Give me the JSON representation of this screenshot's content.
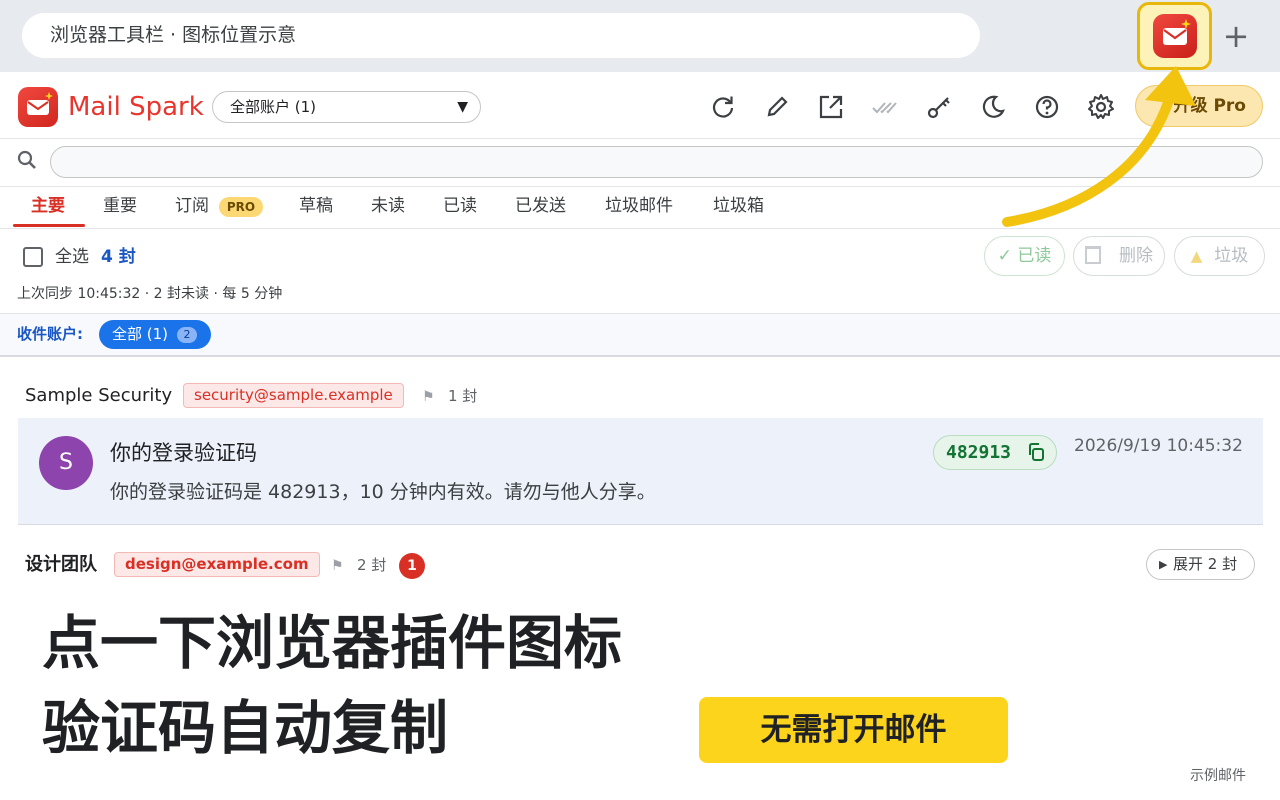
{
  "browser": {
    "address_text": "浏览器工具栏 · 图标位置示意",
    "new_tab_symbol": "+",
    "extension_icon": "mail-extension-icon",
    "highlight_color": "#e8b70c"
  },
  "app": {
    "title": "Mail Spark",
    "account_select_value": "全部账户 (1)",
    "upgrade_label": "升级 Pro",
    "toolbar_icons": [
      "refresh-icon",
      "edit-icon",
      "open-external-icon",
      "mark-read-icon",
      "key-icon",
      "dark-mode-icon",
      "help-icon",
      "settings-icon"
    ]
  },
  "search": {
    "placeholder": ""
  },
  "tabs": [
    {
      "label": "主要",
      "active": true
    },
    {
      "label": "重要"
    },
    {
      "label": "订阅",
      "badge": "PRO"
    },
    {
      "label": "草稿"
    },
    {
      "label": "未读"
    },
    {
      "label": "已读"
    },
    {
      "label": "已发送"
    },
    {
      "label": "垃圾邮件"
    },
    {
      "label": "垃圾箱"
    }
  ],
  "select_row": {
    "select_all_label": "全选",
    "count_label": "4 封",
    "btn_read": "✓ 已读",
    "btn_delete": "删除",
    "btn_junk": "垃圾"
  },
  "sync_status": "上次同步 10:45:32 · 2 封未读 · 每 5 分钟",
  "accounts_filter": {
    "label": "收件账户:",
    "chip_label": "全部 (1)",
    "chip_count": "2"
  },
  "groups": [
    {
      "sender": "Sample Security",
      "email": "security@sample.example",
      "count": "1 封",
      "mail": {
        "avatar_letter": "S",
        "subject": "你的登录验证码",
        "preview": "你的登录验证码是 482913，10 分钟内有效。请勿与他人分享。",
        "code": "482913",
        "date": "2026/9/19 10:45:32"
      }
    },
    {
      "sender": "设计团队",
      "email": "design@example.com",
      "count": "2 封",
      "unread": "1",
      "expand_label": "展开 2 封"
    }
  ],
  "caption": {
    "line1": "点一下浏览器插件图标",
    "line2": "验证码自动复制",
    "button": "无需打开邮件",
    "note": "示例邮件"
  },
  "colors": {
    "brand_red": "#e8362f",
    "accent_blue": "#1a73e8",
    "code_green": "#137333",
    "caption_yellow": "#fcd41c",
    "arrow_yellow": "#f2c30f"
  }
}
